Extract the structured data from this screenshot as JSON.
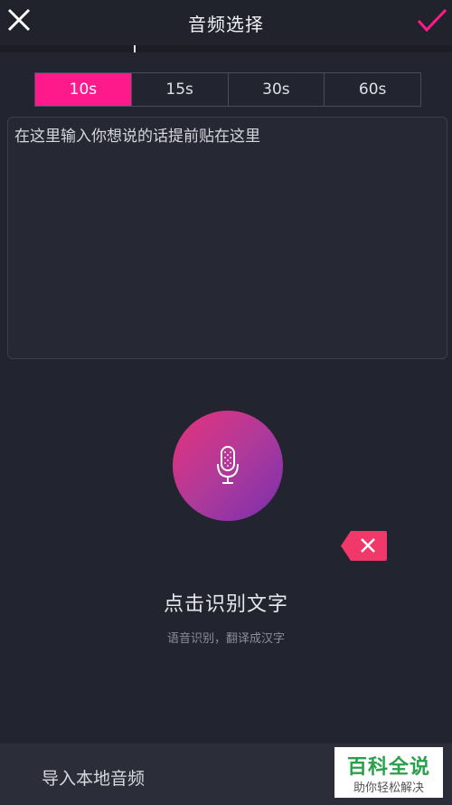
{
  "header": {
    "title": "音频选择",
    "close_icon": "close-icon",
    "confirm_icon": "check-icon",
    "accent_color": "#ff1a8c"
  },
  "durations": {
    "options": [
      "10s",
      "15s",
      "30s",
      "60s"
    ],
    "selected": "10s"
  },
  "textbox": {
    "value": "在这里输入你想说的话提前贴在这里"
  },
  "voice": {
    "mic_icon": "microphone-icon",
    "delete_icon": "backspace-icon",
    "title": "点击识别文字",
    "subtitle": "语音识别，翻译成汉字"
  },
  "footer": {
    "import_label": "导入本地音频"
  },
  "watermark": {
    "line1": "百科全说",
    "line2": "助你轻松解决"
  }
}
